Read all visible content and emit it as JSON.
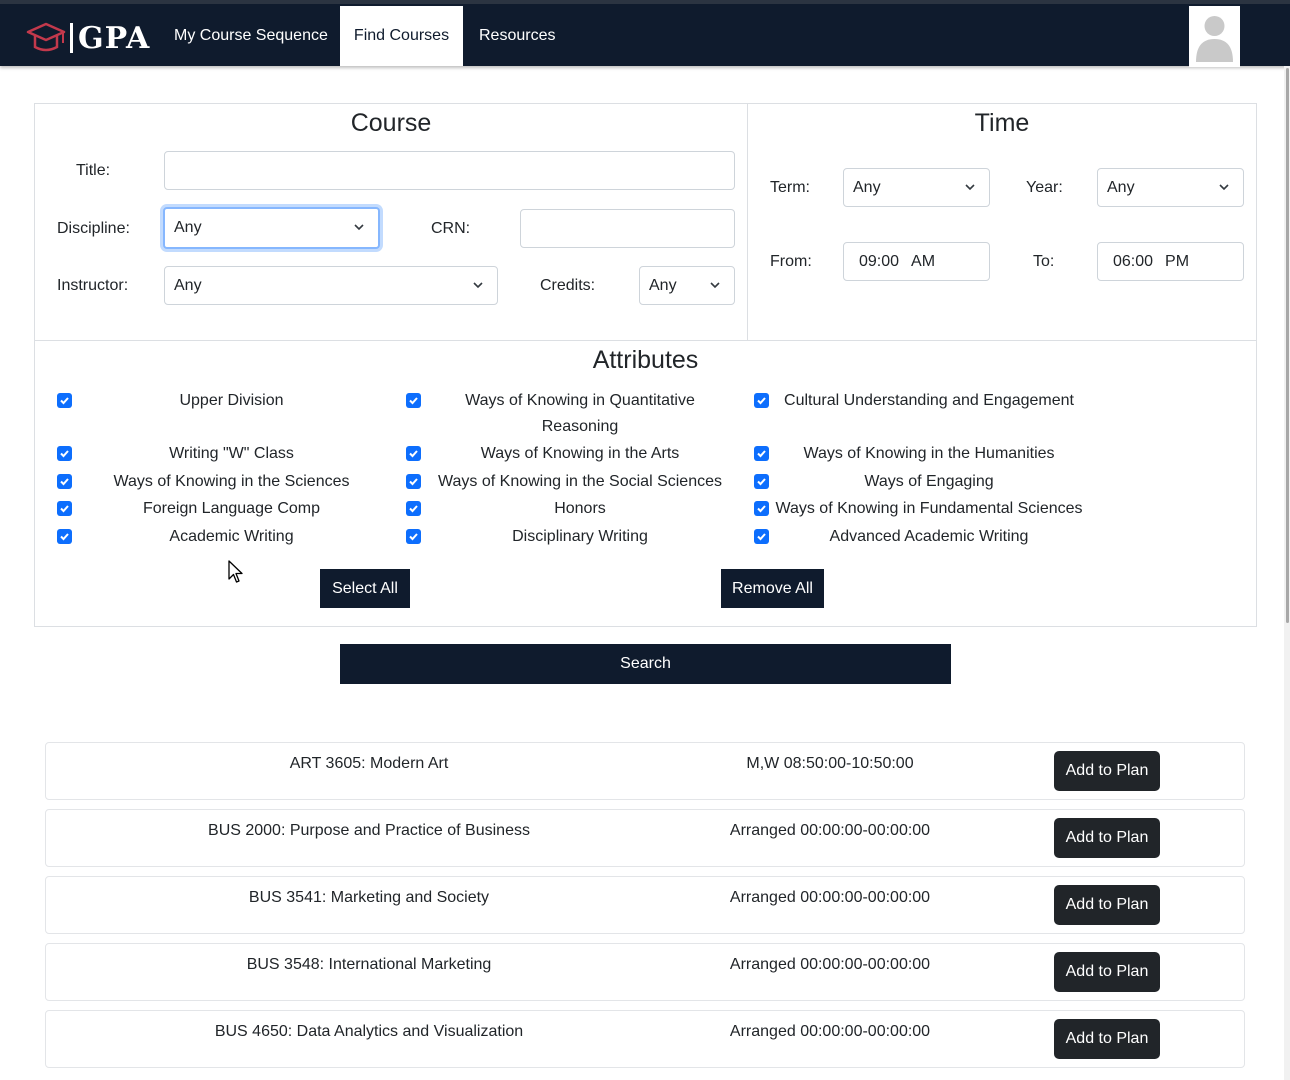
{
  "header": {
    "logo_text": "GPA",
    "nav": [
      {
        "label": "My Course Sequence",
        "active": false
      },
      {
        "label": "Find Courses",
        "active": true
      },
      {
        "label": "Resources",
        "active": false
      }
    ]
  },
  "course_panel": {
    "title": "Course",
    "title_label": "Title:",
    "title_value": "",
    "discipline_label": "Discipline:",
    "discipline_value": "Any",
    "crn_label": "CRN:",
    "crn_value": "",
    "instructor_label": "Instructor:",
    "instructor_value": "Any",
    "credits_label": "Credits:",
    "credits_value": "Any"
  },
  "time_panel": {
    "title": "Time",
    "term_label": "Term:",
    "term_value": "Any",
    "year_label": "Year:",
    "year_value": "Any",
    "from_label": "From:",
    "from_time": "09:00",
    "from_ampm": "AM",
    "to_label": "To:",
    "to_time": "06:00",
    "to_ampm": "PM"
  },
  "attributes": {
    "title": "Attributes",
    "col1": [
      {
        "label": "Upper Division",
        "checked": true
      },
      {
        "label": "Writing \"W\" Class",
        "checked": true
      },
      {
        "label": "Ways of Knowing in the Sciences",
        "checked": true
      },
      {
        "label": "Foreign Language Comp",
        "checked": true
      },
      {
        "label": "Academic Writing",
        "checked": true
      }
    ],
    "col2": [
      {
        "label": "Ways of Knowing in Quantitative Reasoning",
        "checked": true
      },
      {
        "label": "Ways of Knowing in the Arts",
        "checked": true
      },
      {
        "label": "Ways of Knowing in the Social Sciences",
        "checked": true
      },
      {
        "label": "Honors",
        "checked": true
      },
      {
        "label": "Disciplinary Writing",
        "checked": true
      }
    ],
    "col3": [
      {
        "label": "Cultural Understanding and Engagement",
        "checked": true
      },
      {
        "label": "Ways of Knowing in the Humanities",
        "checked": true
      },
      {
        "label": "Ways of Engaging",
        "checked": true
      },
      {
        "label": "Ways of Knowing in Fundamental Sciences",
        "checked": true
      },
      {
        "label": "Advanced Academic Writing",
        "checked": true
      }
    ],
    "select_all_label": "Select All",
    "remove_all_label": "Remove All"
  },
  "search_label": "Search",
  "results": [
    {
      "course": "ART 3605: Modern Art",
      "time": "M,W 08:50:00-10:50:00",
      "action": "Add to Plan"
    },
    {
      "course": "BUS 2000: Purpose and Practice of Business",
      "time": "Arranged 00:00:00-00:00:00",
      "action": "Add to Plan"
    },
    {
      "course": "BUS 3541: Marketing and Society",
      "time": "Arranged 00:00:00-00:00:00",
      "action": "Add to Plan"
    },
    {
      "course": "BUS 3548: International Marketing",
      "time": "Arranged 00:00:00-00:00:00",
      "action": "Add to Plan"
    },
    {
      "course": "BUS 4650: Data Analytics and Visualization",
      "time": "Arranged 00:00:00-00:00:00",
      "action": "Add to Plan"
    }
  ],
  "colors": {
    "navbar": "#0f1b2d",
    "accent_checkbox": "#0d6efd",
    "button_dark": "#0f1b2d",
    "result_button": "#212529",
    "logo_cap": "#c3394c"
  }
}
